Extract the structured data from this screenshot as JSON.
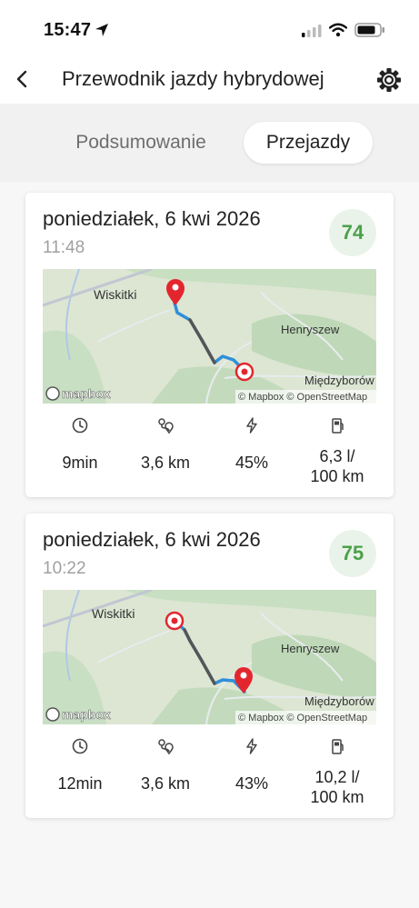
{
  "status": {
    "time": "15:47"
  },
  "header": {
    "title": "Przewodnik jazdy hybrydowej"
  },
  "tabs": [
    {
      "label": "Podsumowanie",
      "active": false
    },
    {
      "label": "Przejazdy",
      "active": true
    }
  ],
  "trips": [
    {
      "date": "poniedziałek, 6 kwi 2026",
      "time": "11:48",
      "score": "74",
      "map": {
        "places": [
          "Wiskitki",
          "Henryszew",
          "Międzyborów"
        ],
        "logo": "mapbox",
        "attribution": "© Mapbox © OpenStreetMap"
      },
      "duration": "9min",
      "distance": "3,6 km",
      "ev_share": "45%",
      "consumption_value": "6,3 l/",
      "consumption_unit": "100 km"
    },
    {
      "date": "poniedziałek, 6 kwi 2026",
      "time": "10:22",
      "score": "75",
      "map": {
        "places": [
          "Wiskitki",
          "Henryszew",
          "Międzyborów"
        ],
        "logo": "mapbox",
        "attribution": "© Mapbox © OpenStreetMap"
      },
      "duration": "12min",
      "distance": "3,6 km",
      "ev_share": "43%",
      "consumption_value": "10,2 l/",
      "consumption_unit": "100 km"
    }
  ],
  "colors": {
    "score_text": "#4aa04a",
    "score_bg": "#eaf3e9",
    "route_ev": "#2f8fd8",
    "route_fuel": "#555555",
    "pin": "#e3262e"
  },
  "icons": [
    "back-arrow-icon",
    "gear-icon",
    "clock-icon",
    "route-icon",
    "bolt-icon",
    "fuel-pump-icon",
    "map-pin-icon",
    "map-target-icon"
  ]
}
